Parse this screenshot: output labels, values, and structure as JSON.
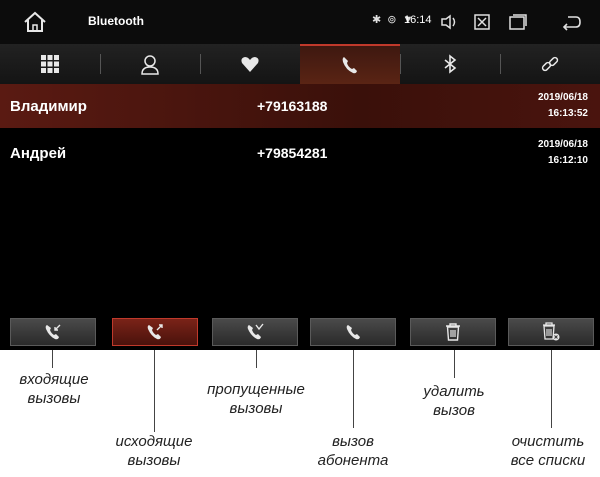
{
  "app": {
    "title": "Bluetooth",
    "time": "16:14"
  },
  "icons": {
    "home": "home-icon",
    "bluetooth": "bluetooth-icon",
    "location": "location-icon",
    "wifi": "wifi-signal-icon",
    "volume": "volume-icon",
    "close": "close-box-icon",
    "windows": "windows-icon",
    "back": "back-arrow-icon"
  },
  "tabs": [
    {
      "icon": "dialpad-icon"
    },
    {
      "icon": "contacts-icon"
    },
    {
      "icon": "favorites-heart-icon"
    },
    {
      "icon": "call-log-icon",
      "active": true
    },
    {
      "icon": "bluetooth-icon"
    },
    {
      "icon": "link-icon"
    }
  ],
  "calls": [
    {
      "name": "Владимир",
      "number": "+79163188",
      "date": "2019/06/18",
      "time": "16:13:52",
      "selected": true
    },
    {
      "name": "Андрей",
      "number": "+79854281",
      "date": "2019/06/18",
      "time": "16:12:10",
      "selected": false
    }
  ],
  "toolbar": [
    {
      "icon": "incoming-calls-icon"
    },
    {
      "icon": "outgoing-calls-icon",
      "active": true
    },
    {
      "icon": "missed-calls-icon"
    },
    {
      "icon": "call-contact-icon"
    },
    {
      "icon": "delete-call-icon"
    },
    {
      "icon": "clear-all-icon"
    }
  ],
  "callouts": {
    "incoming": {
      "line1": "входящие",
      "line2": "вызовы"
    },
    "outgoing": {
      "line1": "исходящие",
      "line2": "вызовы"
    },
    "missed": {
      "line1": "пропущенные",
      "line2": "вызовы"
    },
    "call": {
      "line1": "вызов",
      "line2": "абонента"
    },
    "delete": {
      "line1": "удалить",
      "line2": "вызов"
    },
    "clear": {
      "line1": "очистить",
      "line2": "все списки"
    }
  },
  "colors": {
    "accent": "#c0392b",
    "selected_row": "#5a1a12",
    "background": "#000000"
  }
}
